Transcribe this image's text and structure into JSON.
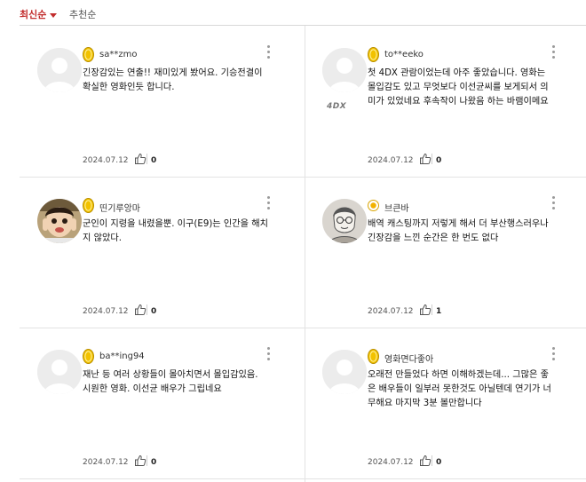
{
  "sort": {
    "latest": "최신순",
    "recommended": "추천순"
  },
  "icons": {
    "like": "thumbs-up-icon",
    "more": "more-vertical-icon",
    "coin": "gold-coin-icon",
    "egg": "egg-icon",
    "sort_caret": "caret-down-icon"
  },
  "colors": {
    "accent": "#c22d2d",
    "coin": "#f2c200",
    "divider": "#e3e3e3"
  },
  "reviews": [
    {
      "user": "sa**zmo",
      "text": "긴장감있는 연출!! 재미있게 봤어요. 기승전결이 확실한 영화인듯 합니다.",
      "date": "2024.07.12",
      "likes": "0",
      "avatar": "default",
      "rank": "gold"
    },
    {
      "user": "to**eeko",
      "text": "첫 4DX 관람이었는데 아주 좋았습니다. 영화는 몰입감도 있고 무엇보다 이선균씨를 보게되서 의미가 있었네요 후속작이 나왔음 하는 바램이메요",
      "date": "2024.07.12",
      "likes": "0",
      "avatar": "default",
      "rank": "gold",
      "format_badge": "4DX"
    },
    {
      "user": "띤기루앙마",
      "text": "군인이 지령을 내렸을뿐. 이구(E9)는 인간을 해치지 않았다.",
      "date": "2024.07.12",
      "likes": "0",
      "avatar": "photo-child",
      "rank": "gold"
    },
    {
      "user": "브큰바",
      "text": "배역 캐스팅까지 저렇게 해서 더 부산행스러우나 긴장감을 느낀 순간은 한 번도 없다",
      "date": "2024.07.12",
      "likes": "1",
      "avatar": "photo-sketch",
      "rank": "egg"
    },
    {
      "user": "ba**ing94",
      "text": "재난 등 여러 상황들이 몰아치면서 몰입감있음. 시원한 영화. 이선균 배우가 그립네요",
      "date": "2024.07.12",
      "likes": "0",
      "avatar": "default",
      "rank": "gold"
    },
    {
      "user": "영화면다좋아",
      "text": "오래전 만들었다 하면 이해하겠는데... 그많은 좋은 배우들이 일부러 못한것도 아닐텐데 연기가 너무해요 마지막 3분 볼만합니다",
      "date": "2024.07.12",
      "likes": "0",
      "avatar": "default",
      "rank": "gold"
    }
  ]
}
